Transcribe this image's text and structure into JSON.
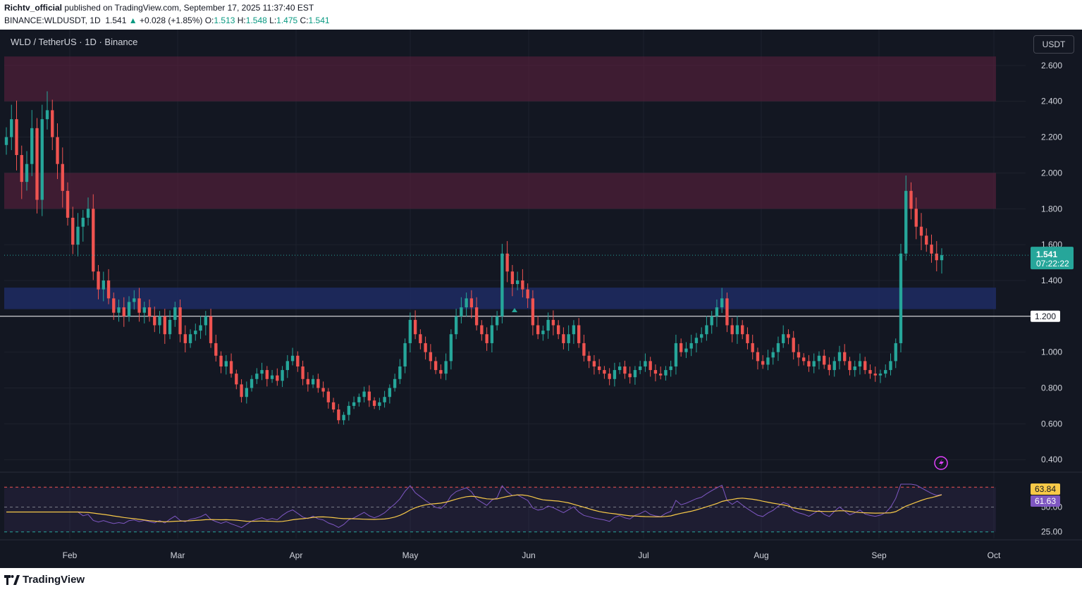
{
  "header": {
    "author": "Richtv_official",
    "published": "published on TradingView.com, September 17, 2025 11:37:40 EST",
    "symbol": "BINANCE:WLDUSDT, 1D",
    "last": "1.541",
    "arrow": "▲",
    "change": "+0.028 (+1.85%)",
    "o_label": "O:",
    "o": "1.513",
    "h_label": "H:",
    "h": "1.548",
    "l_label": "L:",
    "l": "1.475",
    "c_label": "C:",
    "c": "1.541"
  },
  "chart_title": "WLD / TetherUS · 1D · Binance",
  "currency_button": "USDT",
  "price_tag": {
    "value": "1.541",
    "countdown": "07:22:22"
  },
  "line_tag": "1.200",
  "rsi_tags": {
    "rsi": "63.84",
    "ma": "61.63"
  },
  "footer_logo": "TradingView",
  "colors": {
    "background": "#131722",
    "up": "#26a69a",
    "down": "#ef5350",
    "resistance_zone": "#5c1f3d",
    "support_zone": "#1e2c63",
    "rsi_line": "#7e57c2",
    "rsi_ma": "#f7c948"
  },
  "chart_data": {
    "type": "candlestick",
    "price_axis": {
      "ticks": [
        "2.600",
        "2.400",
        "2.200",
        "2.000",
        "1.800",
        "1.600",
        "1.400",
        "1.000",
        "0.800",
        "0.600",
        "0.400"
      ],
      "ylim": [
        0.33,
        2.8
      ]
    },
    "time_axis": [
      "Feb",
      "Mar",
      "Apr",
      "May",
      "Jun",
      "Jul",
      "Aug",
      "Sep",
      "Oct"
    ],
    "rsi_axis": [
      "50.00",
      "25.00"
    ],
    "zones": [
      {
        "kind": "resistance",
        "low": 2.4,
        "high": 2.65
      },
      {
        "kind": "resistance",
        "low": 1.8,
        "high": 2.0
      },
      {
        "kind": "support",
        "low": 1.24,
        "high": 1.36
      }
    ],
    "horizontal_line": 1.2,
    "last_price": 1.541,
    "rsi_last": 63.84,
    "rsi_ma_last": 61.63,
    "closes": [
      2.2,
      2.3,
      2.1,
      1.95,
      2.05,
      2.25,
      1.85,
      2.3,
      2.35,
      2.2,
      2.05,
      1.9,
      1.75,
      1.6,
      1.7,
      1.75,
      1.8,
      1.45,
      1.35,
      1.4,
      1.3,
      1.22,
      1.25,
      1.2,
      1.28,
      1.3,
      1.22,
      1.25,
      1.2,
      1.15,
      1.2,
      1.1,
      1.18,
      1.25,
      1.1,
      1.05,
      1.1,
      1.12,
      1.15,
      1.2,
      1.05,
      0.98,
      0.92,
      0.95,
      0.88,
      0.82,
      0.75,
      0.8,
      0.85,
      0.88,
      0.9,
      0.85,
      0.87,
      0.84,
      0.9,
      0.95,
      0.98,
      0.92,
      0.85,
      0.82,
      0.85,
      0.8,
      0.78,
      0.72,
      0.68,
      0.62,
      0.65,
      0.7,
      0.72,
      0.75,
      0.78,
      0.73,
      0.7,
      0.72,
      0.75,
      0.8,
      0.85,
      0.92,
      1.05,
      1.18,
      1.1,
      1.05,
      1.0,
      0.95,
      0.9,
      0.88,
      0.95,
      1.1,
      1.2,
      1.25,
      1.3,
      1.25,
      1.15,
      1.1,
      1.05,
      1.15,
      1.2,
      1.55,
      1.45,
      1.38,
      1.4,
      1.35,
      1.3,
      1.15,
      1.1,
      1.12,
      1.18,
      1.15,
      1.1,
      1.05,
      1.1,
      1.15,
      1.05,
      0.98,
      0.95,
      0.92,
      0.9,
      0.88,
      0.85,
      0.9,
      0.92,
      0.88,
      0.86,
      0.9,
      0.92,
      0.95,
      0.9,
      0.88,
      0.87,
      0.9,
      0.92,
      1.05,
      1.0,
      1.02,
      1.05,
      1.08,
      1.1,
      1.15,
      1.2,
      1.25,
      1.3,
      1.15,
      1.1,
      1.15,
      1.1,
      1.05,
      1.0,
      0.95,
      0.93,
      0.97,
      1.0,
      1.05,
      1.1,
      1.08,
      1.0,
      0.97,
      0.95,
      0.92,
      0.95,
      0.98,
      0.93,
      0.9,
      0.95,
      1.0,
      0.95,
      0.9,
      0.92,
      0.95,
      0.9,
      0.88,
      0.87,
      0.88,
      0.9,
      0.95,
      1.05,
      1.55,
      1.9,
      1.8,
      1.7,
      1.65,
      1.6,
      1.55,
      1.513,
      1.541
    ]
  }
}
